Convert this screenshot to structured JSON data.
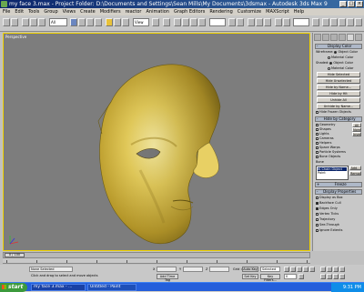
{
  "window": {
    "title": "my face 3.max    - Project Folder: D:\\Documents and Settings\\Sean Mills\\My Documents\\3dsmax    - Autodesk 3ds Max 9"
  },
  "menu": [
    "File",
    "Edit",
    "Tools",
    "Group",
    "Views",
    "Create",
    "Modifiers",
    "reactor",
    "Animation",
    "Graph Editors",
    "Rendering",
    "Customize",
    "MAXScript",
    "Help"
  ],
  "toolbar": {
    "selection_filter": "All",
    "reference_coord": "View"
  },
  "viewport": {
    "label": "Perspective"
  },
  "command_panel": {
    "display_color": {
      "header": "Display Color",
      "wireframe_label": "Wireframe:",
      "shaded_label": "Shaded:",
      "opt_object_color": "Object Color",
      "opt_material_color": "Material Color"
    },
    "hide_by_selection": {
      "buttons": [
        "Hide Selected",
        "Hide Unselected",
        "Hide by Name...",
        "Hide by Hit",
        "Unhide All",
        "Unhide by Name...",
        "Hide Frozen Objects"
      ]
    },
    "hide_by_category": {
      "header": "Hide by Category",
      "categories": [
        "Geometry",
        "Shapes",
        "Lights",
        "Cameras",
        "Helpers",
        "Space Warps",
        "Particle Systems",
        "Bone Objects"
      ],
      "side_buttons": [
        "All",
        "None",
        "Invert"
      ],
      "list_label": "Bone",
      "list_items": [
        "IK Chain Object",
        "Point"
      ],
      "add_label": "Add...",
      "remove_label": "Remove"
    },
    "freeze": {
      "header": "Freeze"
    },
    "display_properties": {
      "header": "Display Properties",
      "items": [
        "Display as Box",
        "Backface Cull",
        "Edges Only",
        "Vertex Ticks",
        "Trajectory",
        "See-Through",
        "Ignore Extents"
      ]
    }
  },
  "timeline": {
    "slider_label": "0 / 100",
    "ticks": [
      "0",
      "10",
      "20",
      "30",
      "40",
      "50",
      "60",
      "70",
      "80",
      "90",
      "100"
    ]
  },
  "status": {
    "selection": "None Selected",
    "prompt": "Click and drag to select and move objects",
    "x_label": "X",
    "y_label": "Y",
    "z_label": "Z",
    "grid": "Grid = 10.0",
    "auto_key": "Auto Key",
    "set_key": "Set Key",
    "selected": "Selected",
    "key_filters": "Key Filters...",
    "add_time_tag": "Add Time Tag",
    "frame": "0"
  },
  "taskbar": {
    "start_label": "start",
    "tasks": [
      "my face 3.max - ...",
      "Untitled - Paint"
    ],
    "clock": "9:31 PM"
  },
  "colors": {
    "title_bar": "#0a246a",
    "viewport_bg": "#7d7d7d",
    "viewport_border": "#f0d200",
    "mesh_gold": "#e0c24a",
    "taskbar_blue": "#245edb",
    "start_green": "#3c9a3c"
  }
}
